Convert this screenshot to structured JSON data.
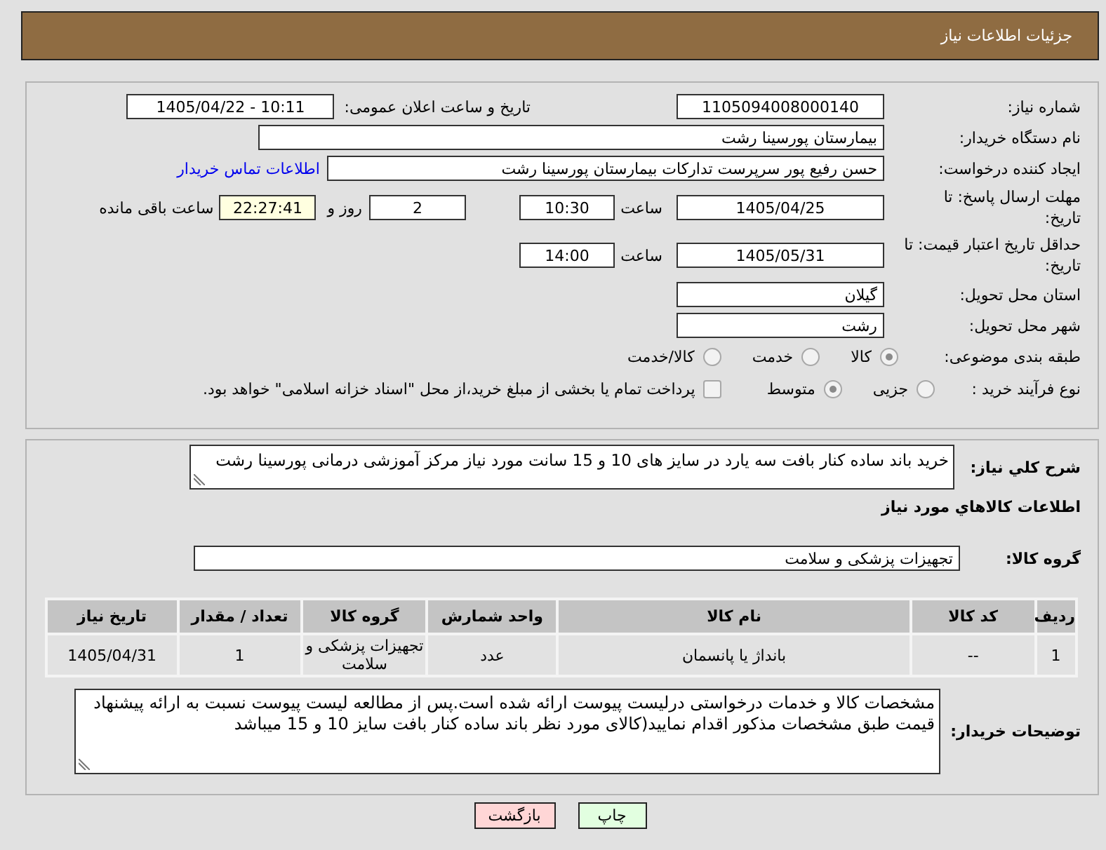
{
  "header": {
    "title": "جزئیات اطلاعات نیاز"
  },
  "details": {
    "need_number": {
      "label": "شماره نیاز:",
      "value": "1105094008000140"
    },
    "announcement": {
      "label": "تاریخ و ساعت اعلان عمومی:",
      "value": "1405/04/22 - 10:11"
    },
    "buyer_org": {
      "label": "نام دستگاه خریدار:",
      "value": "بیمارستان پورسینا رشت"
    },
    "requester": {
      "label": "ایجاد کننده درخواست:",
      "value": "حسن رفیع پور سرپرست تدارکات بیمارستان پورسینا رشت",
      "contact_link": "اطلاعات تماس خریدار"
    },
    "reply_deadline": {
      "label": "مهلت ارسال پاسخ: تا تاریخ:",
      "date": "1405/04/25",
      "time_label": "ساعت",
      "time": "10:30",
      "days": "2",
      "days_label": "روز و",
      "remaining": "22:27:41",
      "remaining_label": "ساعت باقی مانده"
    },
    "price_validity": {
      "label": "حداقل تاریخ اعتبار قیمت: تا تاریخ:",
      "date": "1405/05/31",
      "time_label": "ساعت",
      "time": "14:00"
    },
    "province": {
      "label": "استان محل تحویل:",
      "value": "گیلان"
    },
    "city": {
      "label": "شهر محل تحویل:",
      "value": "رشت"
    },
    "category": {
      "label": "طبقه بندی موضوعی:",
      "disabled": true,
      "options": [
        {
          "label": "کالا",
          "selected": true
        },
        {
          "label": "خدمت",
          "selected": false
        },
        {
          "label": "کالا/خدمت",
          "selected": false
        }
      ]
    },
    "process": {
      "label": "نوع فرآیند خرید :",
      "disabled": true,
      "options": [
        {
          "label": "جزیی",
          "selected": false
        },
        {
          "label": "متوسط",
          "selected": true
        }
      ],
      "treasury": {
        "label": "پرداخت تمام یا بخشی از مبلغ خرید،از محل \"اسناد خزانه اسلامی\" خواهد بود.",
        "checked": false
      }
    }
  },
  "items": {
    "description": {
      "label": "شرح کلي نیاز:",
      "text": "خرید باند ساده کنار بافت سه یارد در سایز های 10 و 15 سانت مورد نیاز مرکز آموزشی درمانی پورسینا رشت"
    },
    "heading": "اطلاعات کالاهاي مورد نیاز",
    "goods_group": {
      "label": "گروه کالا:",
      "value": "تجهیزات پزشکی و سلامت"
    },
    "table": {
      "columns": [
        "ردیف",
        "کد کالا",
        "نام کالا",
        "واحد شمارش",
        "گروه کالا",
        "تعداد / مقدار",
        "تاریخ نیاز"
      ],
      "rows": [
        [
          "1",
          "--",
          "بانداژ یا پانسمان",
          "عدد",
          "تجهیزات پزشکی و سلامت",
          "1",
          "1405/04/31"
        ]
      ]
    },
    "buyer_notes": {
      "label": "توضیحات خریدار:",
      "text": "مشخصات کالا و خدمات درخواستی درلیست پیوست ارائه شده است.پس از مطالعه لیست پیوست نسبت به ارائه پیشنهاد قیمت طبق مشخصات مذکور اقدام نمایید(کالای مورد نظر باند ساده کنار بافت سایز 10 و 15 میباشد"
    }
  },
  "buttons": [
    {
      "label": "چاپ",
      "kind": "print"
    },
    {
      "label": "بازگشت",
      "kind": "back"
    }
  ]
}
